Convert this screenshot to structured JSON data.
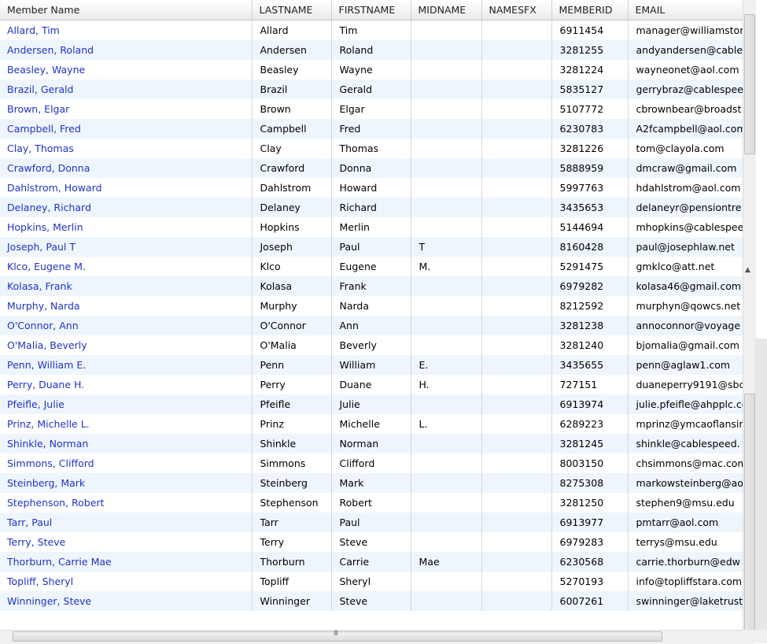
{
  "columns": [
    "Member Name",
    "LASTNAME",
    "FIRSTNAME",
    "MIDNAME",
    "NAMESFX",
    "MEMBERID",
    "EMAIL"
  ],
  "rows": [
    [
      "Allard, Tim",
      "Allard",
      "Tim",
      "",
      "",
      "6911454",
      "manager@williamstor"
    ],
    [
      "Andersen, Roland",
      "Andersen",
      "Roland",
      "",
      "",
      "3281255",
      "andyandersen@cable"
    ],
    [
      "Beasley, Wayne",
      "Beasley",
      "Wayne",
      "",
      "",
      "3281224",
      "wayneonet@aol.com"
    ],
    [
      "Brazil, Gerald",
      "Brazil",
      "Gerald",
      "",
      "",
      "5835127",
      "gerrybraz@cablespee"
    ],
    [
      "Brown, Elgar",
      "Brown",
      "Elgar",
      "",
      "",
      "5107772",
      "cbrownbear@broadst"
    ],
    [
      "Campbell, Fred",
      "Campbell",
      "Fred",
      "",
      "",
      "6230783",
      "A2fcampbell@aol.com"
    ],
    [
      "Clay, Thomas",
      "Clay",
      "Thomas",
      "",
      "",
      "3281226",
      "tom@clayola.com"
    ],
    [
      "Crawford, Donna",
      "Crawford",
      "Donna",
      "",
      "",
      "5888959",
      "dmcraw@gmail.com"
    ],
    [
      "Dahlstrom, Howard",
      "Dahlstrom",
      "Howard",
      "",
      "",
      "5997763",
      "hdahlstrom@aol.com"
    ],
    [
      "Delaney, Richard",
      "Delaney",
      "Richard",
      "",
      "",
      "3435653",
      "delaneyr@pensiontre"
    ],
    [
      "Hopkins, Merlin",
      "Hopkins",
      "Merlin",
      "",
      "",
      "5144694",
      "mhopkins@cablespee"
    ],
    [
      "Joseph, Paul T",
      "Joseph",
      "Paul",
      "T",
      "",
      "8160428",
      "paul@josephlaw.net"
    ],
    [
      "Klco, Eugene M.",
      "Klco",
      "Eugene",
      "M.",
      "",
      "5291475",
      "gmklco@att.net"
    ],
    [
      "Kolasa, Frank",
      "Kolasa",
      "Frank",
      "",
      "",
      "6979282",
      "kolasa46@gmail.com"
    ],
    [
      "Murphy, Narda",
      "Murphy",
      "Narda",
      "",
      "",
      "8212592",
      "murphyn@qowcs.net"
    ],
    [
      "O'Connor, Ann",
      "O'Connor",
      "Ann",
      "",
      "",
      "3281238",
      "annoconnor@voyage"
    ],
    [
      "O'Malia, Beverly",
      "O'Malia",
      "Beverly",
      "",
      "",
      "3281240",
      "bjomalia@gmail.com"
    ],
    [
      "Penn, William E.",
      "Penn",
      "William",
      "E.",
      "",
      "3435655",
      "penn@aglaw1.com"
    ],
    [
      "Perry, Duane H.",
      "Perry",
      "Duane",
      "H.",
      "",
      "727151",
      "duaneperry9191@sbc"
    ],
    [
      "Pfeifle, Julie",
      "Pfeifle",
      "Julie",
      "",
      "",
      "6913974",
      "julie.pfeifle@ahpplc.co"
    ],
    [
      "Prinz, Michelle L.",
      "Prinz",
      "Michelle",
      "L.",
      "",
      "6289223",
      "mprinz@ymcaoflansin"
    ],
    [
      "Shinkle, Norman",
      "Shinkle",
      "Norman",
      "",
      "",
      "3281245",
      "shinkle@cablespeed."
    ],
    [
      "Simmons, Clifford",
      "Simmons",
      "Clifford",
      "",
      "",
      "8003150",
      "chsimmons@mac.com"
    ],
    [
      "Steinberg, Mark",
      "Steinberg",
      "Mark",
      "",
      "",
      "8275308",
      "markowsteinberg@ao"
    ],
    [
      "Stephenson, Robert",
      "Stephenson",
      "Robert",
      "",
      "",
      "3281250",
      "stephen9@msu.edu"
    ],
    [
      "Tarr, Paul",
      "Tarr",
      "Paul",
      "",
      "",
      "6913977",
      "pmtarr@aol.com"
    ],
    [
      "Terry, Steve",
      "Terry",
      "Steve",
      "",
      "",
      "6979283",
      "terrys@msu.edu"
    ],
    [
      "Thorburn, Carrie Mae",
      "Thorburn",
      "Carrie",
      "Mae",
      "",
      "6230568",
      "carrie.thorburn@edw"
    ],
    [
      "Topliff, Sheryl",
      "Topliff",
      "Sheryl",
      "",
      "",
      "5270193",
      "info@topliffstara.com"
    ],
    [
      "Winninger, Steve",
      "Winninger",
      "Steve",
      "",
      "",
      "6007261",
      "swinninger@laketrust"
    ]
  ],
  "scrollbar": {
    "grip": "III",
    "up_arrow": "▲"
  },
  "colors": {
    "link": "#1f33c8",
    "alt_row": "#eef5fd"
  }
}
